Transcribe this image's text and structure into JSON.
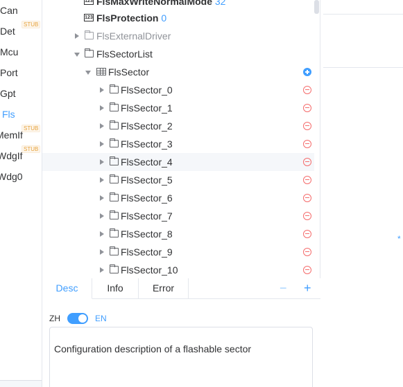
{
  "modules": [
    {
      "label": "Can",
      "stub": ""
    },
    {
      "label": "Det",
      "stub": "STUB"
    },
    {
      "label": "Mcu",
      "stub": ""
    },
    {
      "label": "Port",
      "stub": ""
    },
    {
      "label": "Gpt",
      "stub": ""
    },
    {
      "label": "Fls",
      "stub": "",
      "active": true
    },
    {
      "label": "MemIf",
      "stub": "STUB"
    },
    {
      "label": "WdgIf",
      "stub": "STUB"
    },
    {
      "label": "Wdg0",
      "stub": ""
    }
  ],
  "tree": {
    "params": [
      {
        "label": "FlsMaxWriteNormalMode",
        "value": "32",
        "icon": "numeric-param-icon"
      },
      {
        "label": "FlsProtection",
        "value": "0",
        "icon": "numeric-param-icon"
      }
    ],
    "external_driver": "FlsExternalDriver",
    "sector_list": "FlsSectorList",
    "sector_container": "FlsSector",
    "sectors": [
      "FlsSector_0",
      "FlsSector_1",
      "FlsSector_2",
      "FlsSector_3",
      "FlsSector_4",
      "FlsSector_5",
      "FlsSector_6",
      "FlsSector_7",
      "FlsSector_8",
      "FlsSector_9",
      "FlsSector_10"
    ]
  },
  "tabs": [
    "Desc",
    "Info",
    "Error"
  ],
  "tab_controls": {
    "collapse": "−",
    "expand": "+"
  },
  "lang": {
    "zh": "ZH",
    "en": "EN"
  },
  "description": "Configuration description of a flashable sector",
  "right": {
    "asterisk": "*"
  },
  "colors": {
    "accent": "#409eff",
    "danger": "#f56c6c",
    "stub": "#e6a23c"
  }
}
